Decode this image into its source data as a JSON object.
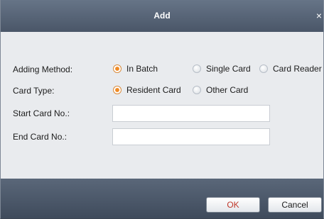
{
  "dialog": {
    "title": "Add",
    "close_glyph": "×"
  },
  "form": {
    "adding_method": {
      "label": "Adding Method:",
      "options": [
        {
          "label": "In Batch",
          "selected": true
        },
        {
          "label": "Single Card",
          "selected": false
        },
        {
          "label": "Card Reader",
          "selected": false
        }
      ]
    },
    "card_type": {
      "label": "Card Type:",
      "options": [
        {
          "label": "Resident Card",
          "selected": true
        },
        {
          "label": "Other Card",
          "selected": false
        }
      ]
    },
    "start_card": {
      "label": "Start Card No.:",
      "value": ""
    },
    "end_card": {
      "label": "End Card No.:",
      "value": ""
    }
  },
  "buttons": {
    "ok": "OK",
    "cancel": "Cancel"
  },
  "colors": {
    "titlebar": "#55627a",
    "body": "#e9ebee",
    "radio_selected": "#f08a24",
    "ok_text": "#c0392b"
  }
}
